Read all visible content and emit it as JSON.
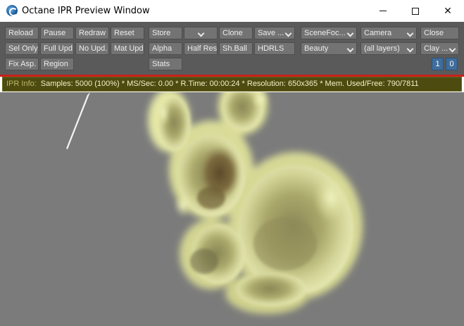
{
  "window": {
    "title": "Octane IPR Preview Window",
    "icon": "octane-logo-icon"
  },
  "toolbar": {
    "row1": {
      "reload": "Reload",
      "pause": "Pause",
      "redraw": "Redraw",
      "reset": "Reset",
      "store": "Store",
      "store_select": "",
      "clone": "Clone",
      "save": "Save ...",
      "scene_focus": "SceneFoc...",
      "camera": "Camera",
      "close": "Close"
    },
    "row2": {
      "sel_only": "Sel Only",
      "full_upd": "Full Upd.",
      "no_upd": "No Upd.",
      "mat_upd": "Mat Upd",
      "alpha": "Alpha",
      "half_res": "Half Res",
      "sh_ball": "Sh.Ball",
      "hdrls": "HDRLS",
      "beauty": "Beauty",
      "layers": "(all layers)",
      "clay": "Clay ..."
    },
    "row3": {
      "fix_asp": "Fix Asp.",
      "region": "Region",
      "stats": "Stats",
      "btn_one": "1",
      "btn_zero": "0"
    }
  },
  "info": {
    "label": "IPR Info:",
    "text": "Samples: 5000 (100%)  *  MS/Sec: 0.00  *  R.Time: 00:00:24  *  Resolution: 650x365  *  Mem. Used/Free: 790/7811"
  },
  "colors": {
    "toolbar_bg": "#5a5a5a",
    "button_bg": "#737373",
    "accent_blue": "#3f6d9c",
    "separator_red": "#c8201c",
    "info_bg": "#4e4b10",
    "viewport_bg": "#7b7b7b"
  }
}
